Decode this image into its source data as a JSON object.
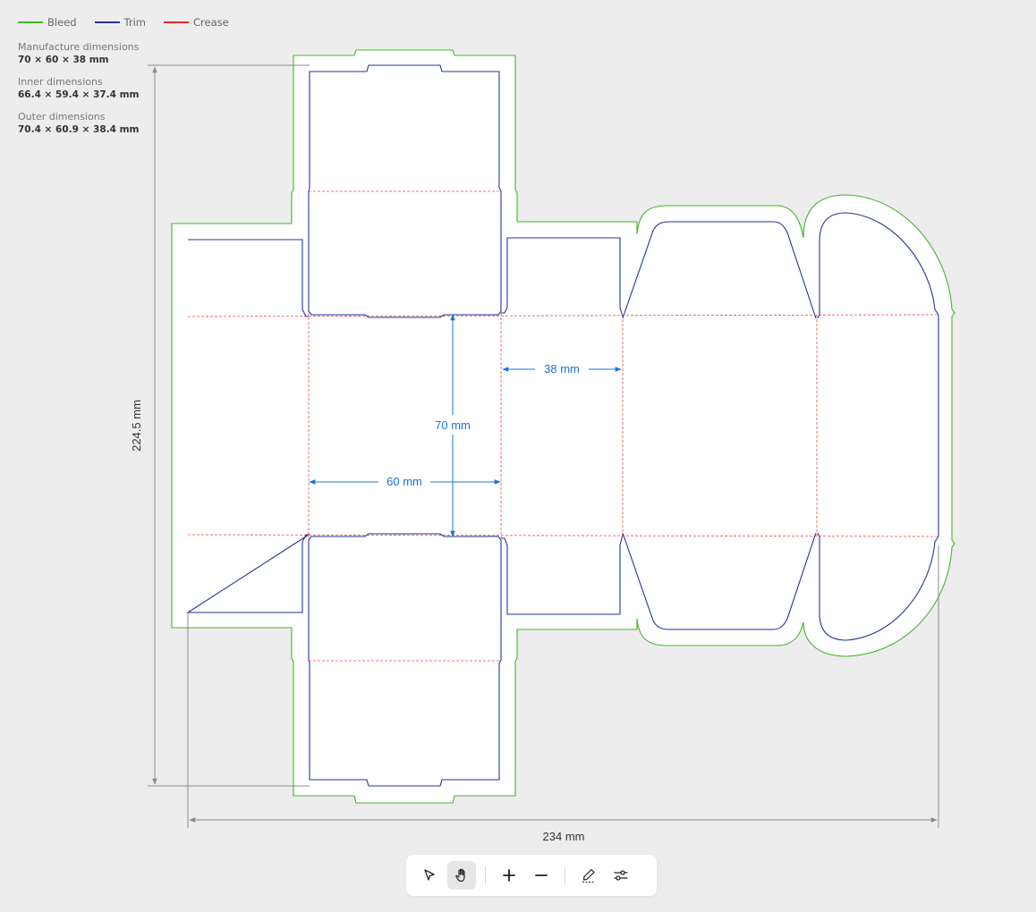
{
  "legend": [
    {
      "label": "Bleed",
      "color": "#44b52c"
    },
    {
      "label": "Trim",
      "color": "#26339a"
    },
    {
      "label": "Crease",
      "color": "#e8272b"
    }
  ],
  "dimensions": [
    {
      "label": "Manufacture dimensions",
      "value": "70 × 60 × 38 mm"
    },
    {
      "label": "Inner dimensions",
      "value": "66.4 × 59.4 × 37.4 mm"
    },
    {
      "label": "Outer dimensions",
      "value": "70.4 × 60.9 × 38.4 mm"
    }
  ],
  "annotations": {
    "total_height": "224.5 mm",
    "total_width": "234 mm",
    "panel_length": "70 mm",
    "panel_width": "60 mm",
    "panel_depth": "38 mm"
  },
  "colors": {
    "bleed": "#44b52c",
    "trim": "#26339a",
    "crease": "#e8272b",
    "measure": "#1a73d9",
    "extent": "#8a8a8a"
  },
  "toolbar": {
    "tools": [
      "select-tool",
      "pan-tool",
      "zoom-in",
      "zoom-out",
      "edit-tool",
      "settings"
    ],
    "active_tool": "pan-tool"
  }
}
